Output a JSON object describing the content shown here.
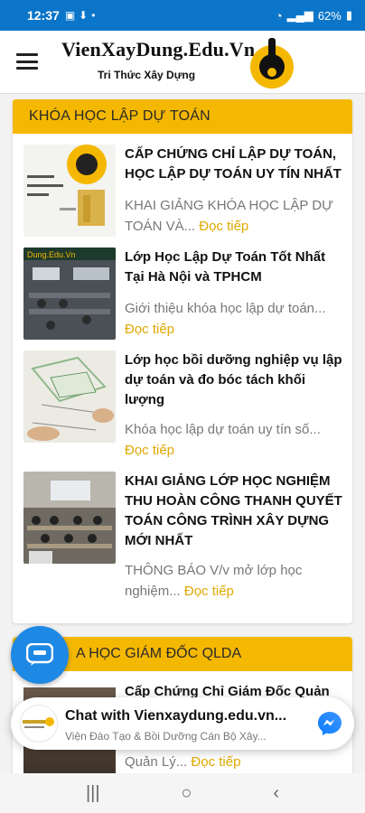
{
  "status_bar": {
    "time": "12:37",
    "battery": "62%"
  },
  "header": {
    "logo_title": "VienXayDung.Edu.Vn",
    "logo_subtitle": "Tri Thức Xây Dựng"
  },
  "section": {
    "title": "KHÓA HỌC LẬP DỰ TOÁN",
    "read_more": "Đọc tiếp",
    "items": [
      {
        "title": "CẤP CHỨNG CHỈ LẬP DỰ TOÁN, HỌC LẬP DỰ TOÁN UY TÍN NHẤT",
        "desc": "KHAI GIẢNG KHÓA HỌC LẬP DỰ TOÁN VÀ..."
      },
      {
        "title": "Lớp Học Lập Dự Toán Tốt Nhất Tại Hà Nội và TPHCM",
        "desc": "Giới thiệu khóa học lập dự toán..."
      },
      {
        "title": "Lớp học bồi dưỡng nghiệp vụ lập dự toán và đo bóc tách khối lượng",
        "desc": "Khóa học lập dự toán uy tín số..."
      },
      {
        "title": "KHAI GIẢNG LỚP HỌC NGHIỆM THU HOÀN CÔNG THANH QUYẾT TOÁN CÔNG TRÌNH XÂY DỰNG MỚI NHẤT",
        "desc": "THÔNG BÁO V/v mở lớp học nghiệm..."
      }
    ]
  },
  "section2": {
    "title": "A HỌC GIÁM ĐỐC QLDA",
    "item_title": "Cấp Chứng Chỉ Giám Đốc Quản",
    "item_desc": "Quản Lý..."
  },
  "chat": {
    "title": "Chat with Vienxaydung.edu.vn...",
    "subtitle": "Viện Đào Tạo & Bồi Dưỡng Cán Bộ Xây..."
  },
  "colors": {
    "status_bar": "#0b75c9",
    "accent": "#f5b800",
    "read_more": "#e0a800"
  }
}
